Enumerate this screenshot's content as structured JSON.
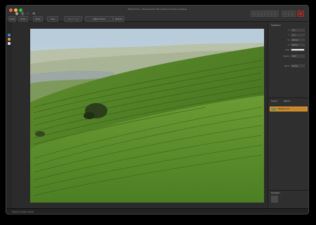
{
  "window": {
    "title": "Affinity Photo - Sheepscombe Hills (Ambient Occlusion).afphoto",
    "colors": {
      "close": "#ff5f57",
      "minimize": "#febc2e",
      "zoom": "#28c840",
      "accent": "#e39a33",
      "bg": "#2a2a2a"
    }
  },
  "toolbar": {
    "left_icons": [
      "photo-persona-icon",
      "liquify-persona-icon",
      "develop-persona-icon",
      "share-icon"
    ],
    "buttons": [
      "Undo",
      "Redo",
      "Snap",
      "Crop"
    ],
    "mid_buttons": [
      "Adjust Tonal",
      "Adjust Colour",
      "Options"
    ],
    "right_icons": [
      "view-icon",
      "assistant-icon",
      "grid-icon",
      "guides-icon",
      "mode-icon",
      "arrange-icon",
      "record-icon"
    ]
  },
  "leftstrip": {
    "swatch_colors": [
      "#4a7fd4",
      "#e39a33",
      "#e0e0e0"
    ]
  },
  "rpanel": {
    "panel_title": "Transform",
    "rows": [
      {
        "label": "X",
        "value": "0 px"
      },
      {
        "label": "Y",
        "value": "0 px"
      },
      {
        "label": "W",
        "value": "4000 px"
      },
      {
        "label": "H",
        "value": "3000 px"
      },
      {
        "label": "Color",
        "value": ""
      },
      {
        "label": "Opacity",
        "value": "100%"
      },
      {
        "label": "Blend",
        "value": "Normal"
      }
    ],
    "tabs": [
      "Layers",
      "Effects"
    ],
    "layer_name": "Background",
    "nav_label": "Navigator"
  },
  "status": {
    "text": "Drag to marquee select."
  }
}
